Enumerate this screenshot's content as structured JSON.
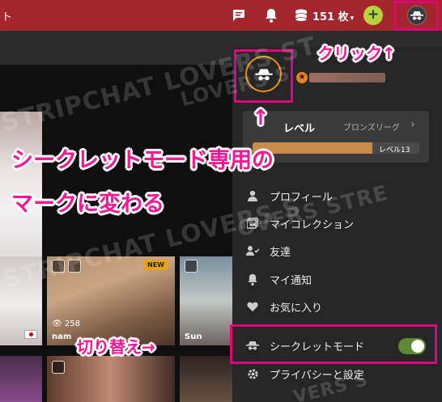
{
  "header": {
    "site_fragment": "ト",
    "tokens_label": "151 枚",
    "tokens_caret": "▾",
    "add_label": "+",
    "icons": [
      "chat-icon",
      "bell-icon",
      "coins-icon",
      "incognito-avatar-icon"
    ],
    "brand_color": "#a2262c"
  },
  "streams": {
    "new_badge": "NEW",
    "card_viewers": "258",
    "card_name": "nam",
    "card_name_right": "Sun",
    "card_viewers_right": "—"
  },
  "dropdown": {
    "level": {
      "label": "レベル",
      "league": "ブロンズリーグ",
      "chevron": "›",
      "progress_text": "レベル13",
      "progress_fraction": 0.72
    },
    "menu": [
      {
        "label": "プロフィール",
        "icon": "user-icon"
      },
      {
        "label": "マイコレクション",
        "icon": "collection-icon"
      },
      {
        "label": "友達",
        "icon": "friends-icon"
      },
      {
        "label": "マイ通知",
        "icon": "bell-icon"
      },
      {
        "label": "お気に入り",
        "icon": "heart-icon"
      },
      {
        "label": "シークレットモード",
        "icon": "incognito-icon",
        "toggle_on": true
      },
      {
        "label": "プライバシーと設定",
        "icon": "gear-icon"
      }
    ]
  },
  "annotations": {
    "click": "クリック↑",
    "mark_line1": "シークレットモード専用の",
    "mark_line2": "マークに変わる",
    "switch": "切り替え→",
    "arrow_up": "↑",
    "highlight_color": "#e3007f"
  },
  "watermark": {
    "text_a": "STRIPCHAT LOVERS S",
    "text_b": "STRIPCHAT LOVERS ST",
    "text_c": "LOVERS S",
    "text_d": "OVERS STRE",
    "text_e": "VERS S"
  }
}
